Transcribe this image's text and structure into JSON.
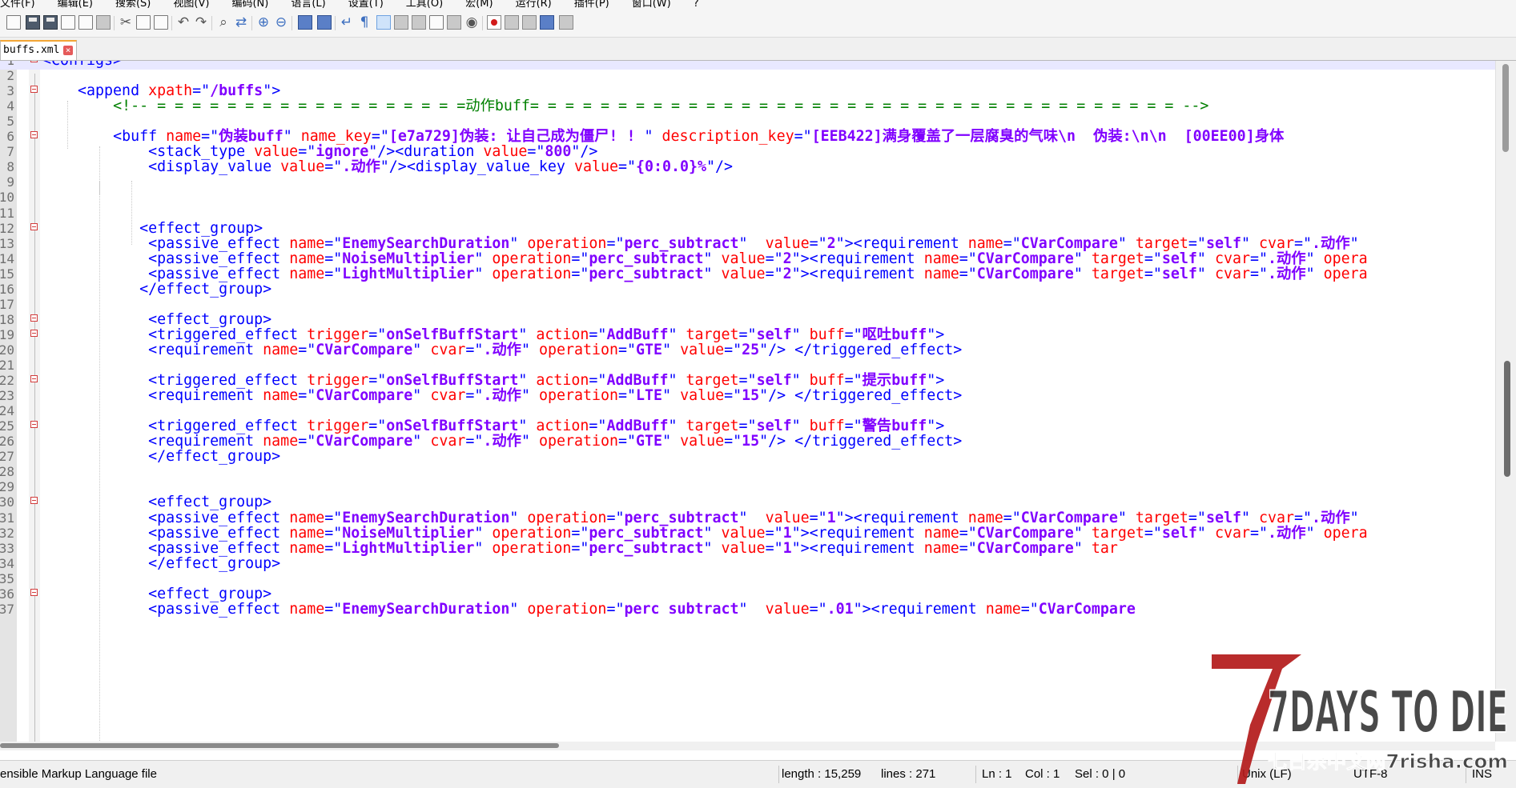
{
  "menu": [
    "文件(F)",
    "编辑(E)",
    "搜索(S)",
    "视图(V)",
    "编码(N)",
    "语言(L)",
    "设置(T)",
    "工具(O)",
    "宏(M)",
    "运行(R)",
    "插件(P)",
    "窗口(W)",
    "?"
  ],
  "tab": {
    "label": "buffs.xml",
    "close": "×"
  },
  "line_numbers": [
    "1",
    "2",
    "3",
    "4",
    "5",
    "6",
    "7",
    "8",
    "9",
    "10",
    "11",
    "12",
    "13",
    "14",
    "15",
    "16",
    "17",
    "18",
    "19",
    "20",
    "21",
    "22",
    "23",
    "24",
    "25",
    "26",
    "27",
    "28",
    "29",
    "30",
    "31",
    "32",
    "33",
    "34",
    "35",
    "36",
    "37"
  ],
  "code_lines": [
    [
      [
        "t",
        "<Configs>"
      ]
    ],
    [],
    [
      [
        "p",
        "    "
      ],
      [
        "t",
        "<append "
      ],
      [
        "a",
        "xpath"
      ],
      [
        "t",
        "=\""
      ],
      [
        "v",
        "/buffs"
      ],
      [
        "t",
        "\">"
      ]
    ],
    [
      [
        "p",
        "        "
      ],
      [
        "c",
        "<!-- = = = = = = = = = = = = = = = = = =动作buff= = = = = = = = = = = = = = = = = = = = = = = = = = = = = = = = = = = = = -->"
      ]
    ],
    [],
    [
      [
        "p",
        "        "
      ],
      [
        "t",
        "<buff "
      ],
      [
        "a",
        "name"
      ],
      [
        "t",
        "=\""
      ],
      [
        "v",
        "伪装buff"
      ],
      [
        "t",
        "\" "
      ],
      [
        "a",
        "name_key"
      ],
      [
        "t",
        "=\""
      ],
      [
        "v",
        "[e7a729]伪装: 让自己成为僵尸! ! "
      ],
      [
        "t",
        "\" "
      ],
      [
        "a",
        "description_key"
      ],
      [
        "t",
        "=\""
      ],
      [
        "v",
        "[EEB422]满身覆盖了一层腐臭的气味\\n  伪装:\\n\\n  [00EE00]身体"
      ]
    ],
    [
      [
        "p",
        "            "
      ],
      [
        "t",
        "<stack_type "
      ],
      [
        "a",
        "value"
      ],
      [
        "t",
        "=\""
      ],
      [
        "v",
        "ignore"
      ],
      [
        "t",
        "\"/><duration "
      ],
      [
        "a",
        "value"
      ],
      [
        "t",
        "=\""
      ],
      [
        "v",
        "800"
      ],
      [
        "t",
        "\"/>"
      ]
    ],
    [
      [
        "p",
        "            "
      ],
      [
        "t",
        "<display_value "
      ],
      [
        "a",
        "value"
      ],
      [
        "t",
        "=\""
      ],
      [
        "v",
        ".动作"
      ],
      [
        "t",
        "\"/><display_value_key "
      ],
      [
        "a",
        "value"
      ],
      [
        "t",
        "=\""
      ],
      [
        "v",
        "{0:0.0}%"
      ],
      [
        "t",
        "\"/>"
      ]
    ],
    [],
    [],
    [],
    [
      [
        "p",
        "           "
      ],
      [
        "t",
        "<effect_group>"
      ]
    ],
    [
      [
        "p",
        "            "
      ],
      [
        "t",
        "<passive_effect "
      ],
      [
        "a",
        "name"
      ],
      [
        "t",
        "=\""
      ],
      [
        "v",
        "EnemySearchDuration"
      ],
      [
        "t",
        "\" "
      ],
      [
        "a",
        "operation"
      ],
      [
        "t",
        "=\""
      ],
      [
        "v",
        "perc_subtract"
      ],
      [
        "t",
        "\"  "
      ],
      [
        "a",
        "value"
      ],
      [
        "t",
        "=\""
      ],
      [
        "v",
        "2"
      ],
      [
        "t",
        "\"><requirement "
      ],
      [
        "a",
        "name"
      ],
      [
        "t",
        "=\""
      ],
      [
        "v",
        "CVarCompare"
      ],
      [
        "t",
        "\" "
      ],
      [
        "a",
        "target"
      ],
      [
        "t",
        "=\""
      ],
      [
        "v",
        "self"
      ],
      [
        "t",
        "\" "
      ],
      [
        "a",
        "cvar"
      ],
      [
        "t",
        "=\""
      ],
      [
        "v",
        ".动作"
      ],
      [
        "t",
        "\""
      ]
    ],
    [
      [
        "p",
        "            "
      ],
      [
        "t",
        "<passive_effect "
      ],
      [
        "a",
        "name"
      ],
      [
        "t",
        "=\""
      ],
      [
        "v",
        "NoiseMultiplier"
      ],
      [
        "t",
        "\" "
      ],
      [
        "a",
        "operation"
      ],
      [
        "t",
        "=\""
      ],
      [
        "v",
        "perc_subtract"
      ],
      [
        "t",
        "\" "
      ],
      [
        "a",
        "value"
      ],
      [
        "t",
        "=\""
      ],
      [
        "v",
        "2"
      ],
      [
        "t",
        "\"><requirement "
      ],
      [
        "a",
        "name"
      ],
      [
        "t",
        "=\""
      ],
      [
        "v",
        "CVarCompare"
      ],
      [
        "t",
        "\" "
      ],
      [
        "a",
        "target"
      ],
      [
        "t",
        "=\""
      ],
      [
        "v",
        "self"
      ],
      [
        "t",
        "\" "
      ],
      [
        "a",
        "cvar"
      ],
      [
        "t",
        "=\""
      ],
      [
        "v",
        ".动作"
      ],
      [
        "t",
        "\" "
      ],
      [
        "a",
        "opera"
      ]
    ],
    [
      [
        "p",
        "            "
      ],
      [
        "t",
        "<passive_effect "
      ],
      [
        "a",
        "name"
      ],
      [
        "t",
        "=\""
      ],
      [
        "v",
        "LightMultiplier"
      ],
      [
        "t",
        "\" "
      ],
      [
        "a",
        "operation"
      ],
      [
        "t",
        "=\""
      ],
      [
        "v",
        "perc_subtract"
      ],
      [
        "t",
        "\" "
      ],
      [
        "a",
        "value"
      ],
      [
        "t",
        "=\""
      ],
      [
        "v",
        "2"
      ],
      [
        "t",
        "\"><requirement "
      ],
      [
        "a",
        "name"
      ],
      [
        "t",
        "=\""
      ],
      [
        "v",
        "CVarCompare"
      ],
      [
        "t",
        "\" "
      ],
      [
        "a",
        "target"
      ],
      [
        "t",
        "=\""
      ],
      [
        "v",
        "self"
      ],
      [
        "t",
        "\" "
      ],
      [
        "a",
        "cvar"
      ],
      [
        "t",
        "=\""
      ],
      [
        "v",
        ".动作"
      ],
      [
        "t",
        "\" "
      ],
      [
        "a",
        "opera"
      ]
    ],
    [
      [
        "p",
        "           "
      ],
      [
        "t",
        "</effect_group>"
      ]
    ],
    [],
    [
      [
        "p",
        "            "
      ],
      [
        "t",
        "<effect_group>"
      ]
    ],
    [
      [
        "p",
        "            "
      ],
      [
        "t",
        "<triggered_effect "
      ],
      [
        "a",
        "trigger"
      ],
      [
        "t",
        "=\""
      ],
      [
        "v",
        "onSelfBuffStart"
      ],
      [
        "t",
        "\" "
      ],
      [
        "a",
        "action"
      ],
      [
        "t",
        "=\""
      ],
      [
        "v",
        "AddBuff"
      ],
      [
        "t",
        "\" "
      ],
      [
        "a",
        "target"
      ],
      [
        "t",
        "=\""
      ],
      [
        "v",
        "self"
      ],
      [
        "t",
        "\" "
      ],
      [
        "a",
        "buff"
      ],
      [
        "t",
        "=\""
      ],
      [
        "v",
        "呕吐buff"
      ],
      [
        "t",
        "\">"
      ]
    ],
    [
      [
        "p",
        "            "
      ],
      [
        "t",
        "<requirement "
      ],
      [
        "a",
        "name"
      ],
      [
        "t",
        "=\""
      ],
      [
        "v",
        "CVarCompare"
      ],
      [
        "t",
        "\" "
      ],
      [
        "a",
        "cvar"
      ],
      [
        "t",
        "=\""
      ],
      [
        "v",
        ".动作"
      ],
      [
        "t",
        "\" "
      ],
      [
        "a",
        "operation"
      ],
      [
        "t",
        "=\""
      ],
      [
        "v",
        "GTE"
      ],
      [
        "t",
        "\" "
      ],
      [
        "a",
        "value"
      ],
      [
        "t",
        "=\""
      ],
      [
        "v",
        "25"
      ],
      [
        "t",
        "\"/> </triggered_effect>"
      ]
    ],
    [],
    [
      [
        "p",
        "            "
      ],
      [
        "t",
        "<triggered_effect "
      ],
      [
        "a",
        "trigger"
      ],
      [
        "t",
        "=\""
      ],
      [
        "v",
        "onSelfBuffStart"
      ],
      [
        "t",
        "\" "
      ],
      [
        "a",
        "action"
      ],
      [
        "t",
        "=\""
      ],
      [
        "v",
        "AddBuff"
      ],
      [
        "t",
        "\" "
      ],
      [
        "a",
        "target"
      ],
      [
        "t",
        "=\""
      ],
      [
        "v",
        "self"
      ],
      [
        "t",
        "\" "
      ],
      [
        "a",
        "buff"
      ],
      [
        "t",
        "=\""
      ],
      [
        "v",
        "提示buff"
      ],
      [
        "t",
        "\">"
      ]
    ],
    [
      [
        "p",
        "            "
      ],
      [
        "t",
        "<requirement "
      ],
      [
        "a",
        "name"
      ],
      [
        "t",
        "=\""
      ],
      [
        "v",
        "CVarCompare"
      ],
      [
        "t",
        "\" "
      ],
      [
        "a",
        "cvar"
      ],
      [
        "t",
        "=\""
      ],
      [
        "v",
        ".动作"
      ],
      [
        "t",
        "\" "
      ],
      [
        "a",
        "operation"
      ],
      [
        "t",
        "=\""
      ],
      [
        "v",
        "LTE"
      ],
      [
        "t",
        "\" "
      ],
      [
        "a",
        "value"
      ],
      [
        "t",
        "=\""
      ],
      [
        "v",
        "15"
      ],
      [
        "t",
        "\"/> </triggered_effect>"
      ]
    ],
    [],
    [
      [
        "p",
        "            "
      ],
      [
        "t",
        "<triggered_effect "
      ],
      [
        "a",
        "trigger"
      ],
      [
        "t",
        "=\""
      ],
      [
        "v",
        "onSelfBuffStart"
      ],
      [
        "t",
        "\" "
      ],
      [
        "a",
        "action"
      ],
      [
        "t",
        "=\""
      ],
      [
        "v",
        "AddBuff"
      ],
      [
        "t",
        "\" "
      ],
      [
        "a",
        "target"
      ],
      [
        "t",
        "=\""
      ],
      [
        "v",
        "self"
      ],
      [
        "t",
        "\" "
      ],
      [
        "a",
        "buff"
      ],
      [
        "t",
        "=\""
      ],
      [
        "v",
        "警告buff"
      ],
      [
        "t",
        "\">"
      ]
    ],
    [
      [
        "p",
        "            "
      ],
      [
        "t",
        "<requirement "
      ],
      [
        "a",
        "name"
      ],
      [
        "t",
        "=\""
      ],
      [
        "v",
        "CVarCompare"
      ],
      [
        "t",
        "\" "
      ],
      [
        "a",
        "cvar"
      ],
      [
        "t",
        "=\""
      ],
      [
        "v",
        ".动作"
      ],
      [
        "t",
        "\" "
      ],
      [
        "a",
        "operation"
      ],
      [
        "t",
        "=\""
      ],
      [
        "v",
        "GTE"
      ],
      [
        "t",
        "\" "
      ],
      [
        "a",
        "value"
      ],
      [
        "t",
        "=\""
      ],
      [
        "v",
        "15"
      ],
      [
        "t",
        "\"/> </triggered_effect>"
      ]
    ],
    [
      [
        "p",
        "            "
      ],
      [
        "t",
        "</effect_group>"
      ]
    ],
    [],
    [],
    [
      [
        "p",
        "            "
      ],
      [
        "t",
        "<effect_group>"
      ]
    ],
    [
      [
        "p",
        "            "
      ],
      [
        "t",
        "<passive_effect "
      ],
      [
        "a",
        "name"
      ],
      [
        "t",
        "=\""
      ],
      [
        "v",
        "EnemySearchDuration"
      ],
      [
        "t",
        "\" "
      ],
      [
        "a",
        "operation"
      ],
      [
        "t",
        "=\""
      ],
      [
        "v",
        "perc_subtract"
      ],
      [
        "t",
        "\"  "
      ],
      [
        "a",
        "value"
      ],
      [
        "t",
        "=\""
      ],
      [
        "v",
        "1"
      ],
      [
        "t",
        "\"><requirement "
      ],
      [
        "a",
        "name"
      ],
      [
        "t",
        "=\""
      ],
      [
        "v",
        "CVarCompare"
      ],
      [
        "t",
        "\" "
      ],
      [
        "a",
        "target"
      ],
      [
        "t",
        "=\""
      ],
      [
        "v",
        "self"
      ],
      [
        "t",
        "\" "
      ],
      [
        "a",
        "cvar"
      ],
      [
        "t",
        "=\""
      ],
      [
        "v",
        ".动作"
      ],
      [
        "t",
        "\""
      ]
    ],
    [
      [
        "p",
        "            "
      ],
      [
        "t",
        "<passive_effect "
      ],
      [
        "a",
        "name"
      ],
      [
        "t",
        "=\""
      ],
      [
        "v",
        "NoiseMultiplier"
      ],
      [
        "t",
        "\" "
      ],
      [
        "a",
        "operation"
      ],
      [
        "t",
        "=\""
      ],
      [
        "v",
        "perc_subtract"
      ],
      [
        "t",
        "\" "
      ],
      [
        "a",
        "value"
      ],
      [
        "t",
        "=\""
      ],
      [
        "v",
        "1"
      ],
      [
        "t",
        "\"><requirement "
      ],
      [
        "a",
        "name"
      ],
      [
        "t",
        "=\""
      ],
      [
        "v",
        "CVarCompare"
      ],
      [
        "t",
        "\" "
      ],
      [
        "a",
        "target"
      ],
      [
        "t",
        "=\""
      ],
      [
        "v",
        "self"
      ],
      [
        "t",
        "\" "
      ],
      [
        "a",
        "cvar"
      ],
      [
        "t",
        "=\""
      ],
      [
        "v",
        ".动作"
      ],
      [
        "t",
        "\" "
      ],
      [
        "a",
        "opera"
      ]
    ],
    [
      [
        "p",
        "            "
      ],
      [
        "t",
        "<passive_effect "
      ],
      [
        "a",
        "name"
      ],
      [
        "t",
        "=\""
      ],
      [
        "v",
        "LightMultiplier"
      ],
      [
        "t",
        "\" "
      ],
      [
        "a",
        "operation"
      ],
      [
        "t",
        "=\""
      ],
      [
        "v",
        "perc_subtract"
      ],
      [
        "t",
        "\" "
      ],
      [
        "a",
        "value"
      ],
      [
        "t",
        "=\""
      ],
      [
        "v",
        "1"
      ],
      [
        "t",
        "\"><requirement "
      ],
      [
        "a",
        "name"
      ],
      [
        "t",
        "=\""
      ],
      [
        "v",
        "CVarCompare"
      ],
      [
        "t",
        "\" "
      ],
      [
        "a",
        "tar"
      ]
    ],
    [
      [
        "p",
        "            "
      ],
      [
        "t",
        "</effect_group>"
      ]
    ],
    [],
    [
      [
        "p",
        "            "
      ],
      [
        "t",
        "<effect_group>"
      ]
    ],
    [
      [
        "p",
        "            "
      ],
      [
        "t",
        "<passive_effect "
      ],
      [
        "a",
        "name"
      ],
      [
        "t",
        "=\""
      ],
      [
        "v",
        "EnemySearchDuration"
      ],
      [
        "t",
        "\" "
      ],
      [
        "a",
        "operation"
      ],
      [
        "t",
        "=\""
      ],
      [
        "v",
        "perc subtract"
      ],
      [
        "t",
        "\"  "
      ],
      [
        "a",
        "value"
      ],
      [
        "t",
        "=\""
      ],
      [
        "v",
        ".01"
      ],
      [
        "t",
        "\"><requirement "
      ],
      [
        "a",
        "name"
      ],
      [
        "t",
        "=\""
      ],
      [
        "v",
        "CVarCompare"
      ]
    ]
  ],
  "status": {
    "file_type": "ensible Markup Language file",
    "length": "length : 15,259",
    "lines": "lines : 271",
    "ln": "Ln : 1",
    "col": "Col : 1",
    "sel": "Sel : 0 | 0",
    "eol": "Unix (LF)",
    "encoding": "UTF-8",
    "mode": "INS"
  },
  "watermark": {
    "title": "7DAYS TO DIE",
    "subtitle": "七日杀中文网7risha.com"
  },
  "colors": {
    "tag": "#0000ff",
    "attr": "#ff0000",
    "value": "#8000ff",
    "comment": "#008000",
    "current_line": "#e8e8ff"
  }
}
